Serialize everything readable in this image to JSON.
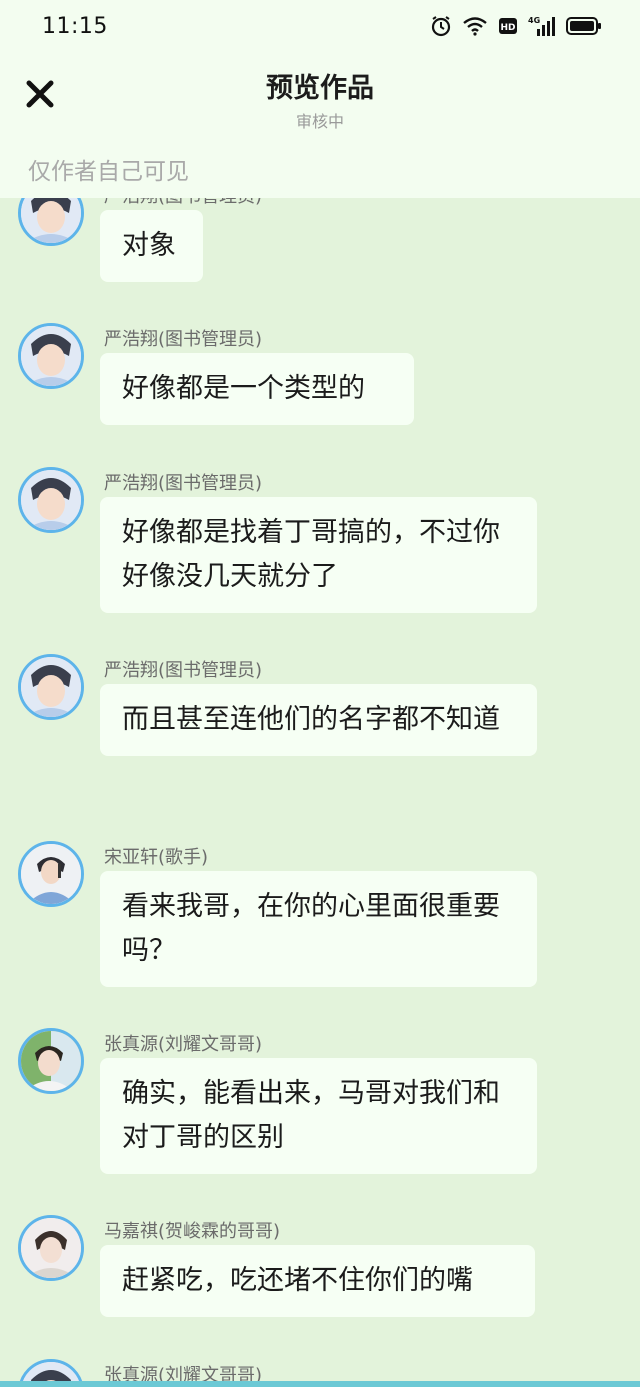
{
  "status_bar": {
    "time": "11:15",
    "network": "4G"
  },
  "header": {
    "title": "预览作品",
    "subtitle": "审核中",
    "notice": "仅作者自己可见"
  },
  "messages": [
    {
      "name": "严浩翔(图书管理员)",
      "text": "对象"
    },
    {
      "name": "严浩翔(图书管理员)",
      "text": "好像都是一个类型的"
    },
    {
      "name": "严浩翔(图书管理员)",
      "text": "好像都是找着丁哥搞的，不过你好像没几天就分了"
    },
    {
      "name": "严浩翔(图书管理员)",
      "text": "而且甚至连他们的名字都不知道"
    },
    {
      "name": "宋亚轩(歌手)",
      "text": "看来我哥，在你的心里面很重要吗？"
    },
    {
      "name": "张真源(刘耀文哥哥)",
      "text": "确实，能看出来，马哥对我们和对丁哥的区别"
    },
    {
      "name": "马嘉祺(贺峻霖的哥哥)",
      "text": "赶紧吃，吃还堵不住你们的嘴"
    },
    {
      "name": "张真源(刘耀文哥哥)",
      "text": ""
    }
  ],
  "colors": {
    "background": "#e3f3db",
    "bubble": "#f6fff4",
    "avatar_ring": "#5db4ea",
    "header": "#f3fdf0"
  }
}
